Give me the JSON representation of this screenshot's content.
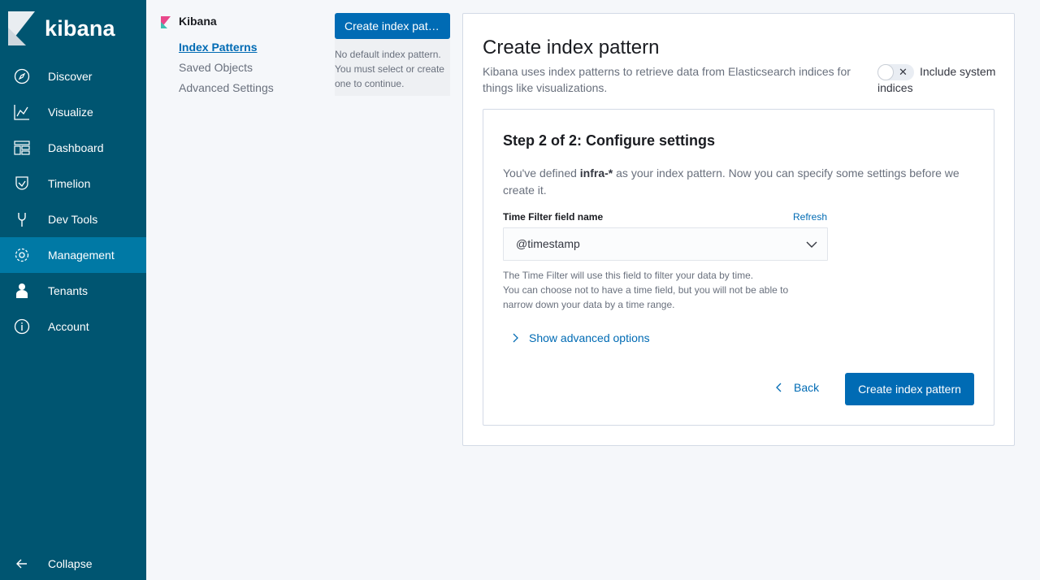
{
  "app": {
    "name": "kibana"
  },
  "sidebar": {
    "items": [
      {
        "label": "Discover",
        "icon": "compass-icon"
      },
      {
        "label": "Visualize",
        "icon": "chart-icon"
      },
      {
        "label": "Dashboard",
        "icon": "dashboard-icon"
      },
      {
        "label": "Timelion",
        "icon": "timelion-icon"
      },
      {
        "label": "Dev Tools",
        "icon": "wrench-icon"
      },
      {
        "label": "Management",
        "icon": "gear-icon",
        "active": true
      },
      {
        "label": "Tenants",
        "icon": "user-icon"
      },
      {
        "label": "Account",
        "icon": "info-icon"
      }
    ],
    "collapse_label": "Collapse"
  },
  "subnav": {
    "title": "Kibana",
    "links": [
      "Index Patterns",
      "Saved Objects",
      "Advanced Settings"
    ],
    "active": "Index Patterns"
  },
  "default_panel": {
    "button_label": "Create index pattern",
    "note": "No default index pattern. You must select or create one to continue."
  },
  "main": {
    "title": "Create index pattern",
    "description": "Kibana uses index patterns to retrieve data from Elasticsearch indices for things like visualizations.",
    "include_system_label": "Include system indices",
    "include_system_on": false
  },
  "step": {
    "title": "Step 2 of 2: Configure settings",
    "desc_prefix": "You've defined ",
    "pattern": "infra-*",
    "desc_suffix": " as your index pattern. Now you can specify some settings before we create it.",
    "field_label": "Time Filter field name",
    "refresh_label": "Refresh",
    "selected_field": "@timestamp",
    "help_line1": "The Time Filter will use this field to filter your data by time.",
    "help_line2": "You can choose not to have a time field, but you will not be able to narrow down your data by a time range.",
    "advanced_label": "Show advanced options",
    "back_label": "Back",
    "create_label": "Create index pattern"
  },
  "colors": {
    "sidebar_bg": "#005571",
    "sidebar_active": "#0079a5",
    "primary": "#006bb4"
  }
}
